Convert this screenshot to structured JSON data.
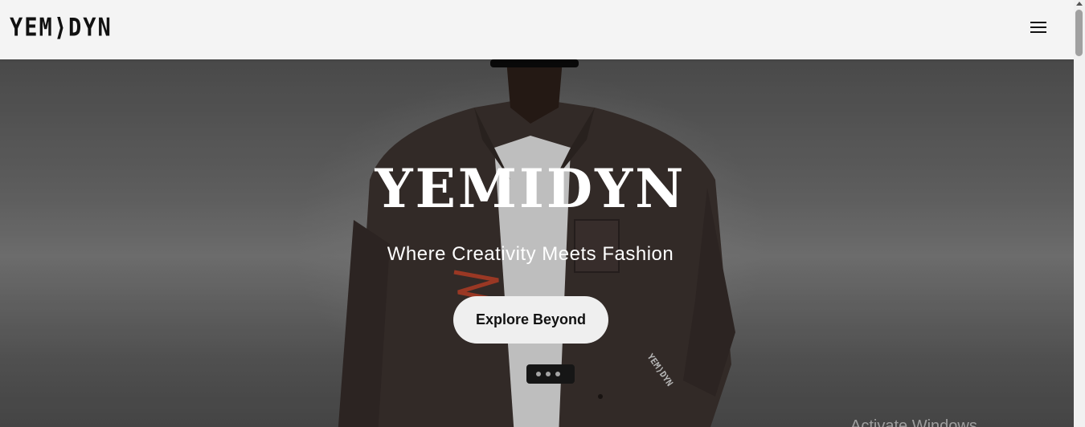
{
  "header": {
    "logo_text": "YEM⟩DYN",
    "menu_icon": "hamburger-menu-icon"
  },
  "hero": {
    "title": "YEMIDYN",
    "subtitle": "Where Creativity Meets Fashion",
    "cta_label": "Explore Beyond",
    "jacket_print": "YEM⟩DYN"
  },
  "watermark": {
    "text": "Activate Windows"
  },
  "colors": {
    "header_bg": "#f4f4f4",
    "text_dark": "#111111",
    "hero_text": "#ffffff",
    "button_bg": "#efefef"
  }
}
